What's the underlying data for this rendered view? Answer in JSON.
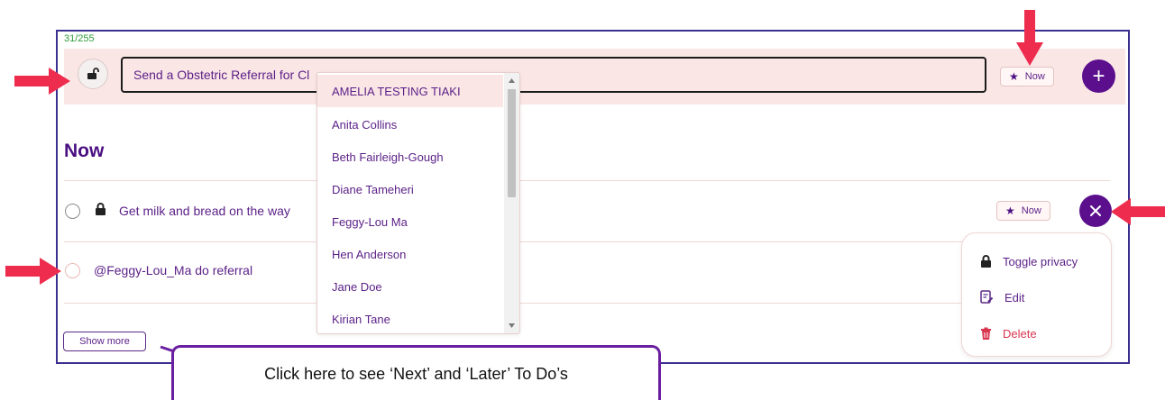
{
  "composer": {
    "counter": "31/255",
    "input_value": "Send a Obstetric Referral for Cl",
    "when_label": "Now",
    "lock_icon": "unlock-icon",
    "add_icon": "plus-icon"
  },
  "mention_dropdown": {
    "items": [
      "AMELIA TESTING TIAKI",
      "Anita Collins",
      "Beth Fairleigh-Gough",
      "Diane Tameheri",
      "Feggy-Lou Ma",
      "Hen Anderson",
      "Jane Doe",
      "Kirian Tane"
    ],
    "selected_index": 0
  },
  "section": {
    "title": "Now"
  },
  "todos": [
    {
      "text": "Get milk and bread on the way",
      "private": true,
      "when_label": "Now"
    },
    {
      "text": "@Feggy-Lou_Ma do referral",
      "private": false
    }
  ],
  "context_menu": {
    "items": [
      {
        "label": "Toggle privacy",
        "icon": "lock-icon"
      },
      {
        "label": "Edit",
        "icon": "edit-icon"
      },
      {
        "label": "Delete",
        "icon": "trash-icon"
      }
    ]
  },
  "show_more_label": "Show more",
  "callout_text": "Click here to see ‘Next’ and ‘Later’ To Do’s",
  "colors": {
    "accent": "#5b0f8c",
    "bar_bg": "#fbe6e6",
    "annotation_arrow": "#ee2c4d",
    "counter_green": "#2e9b3a",
    "delete_red": "#d8364f"
  }
}
